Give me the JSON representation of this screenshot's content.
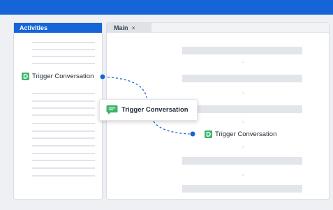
{
  "colors": {
    "accent": "#1565d8",
    "node_green": "#3cb56a",
    "connector": "#1565d8"
  },
  "activities_panel": {
    "title": "Activities",
    "source_item": {
      "label": "Trigger Conversation",
      "icon": "trigger-conversation-icon"
    }
  },
  "main_panel": {
    "tab": {
      "label": "Main",
      "close_symbol": "×"
    },
    "flow_arrow_symbol": "↓",
    "target_node": {
      "label": "Trigger Conversation",
      "icon": "trigger-conversation-icon"
    }
  },
  "drag_preview": {
    "label": "Trigger Conversation",
    "icon": "chat-bubble-icon"
  }
}
